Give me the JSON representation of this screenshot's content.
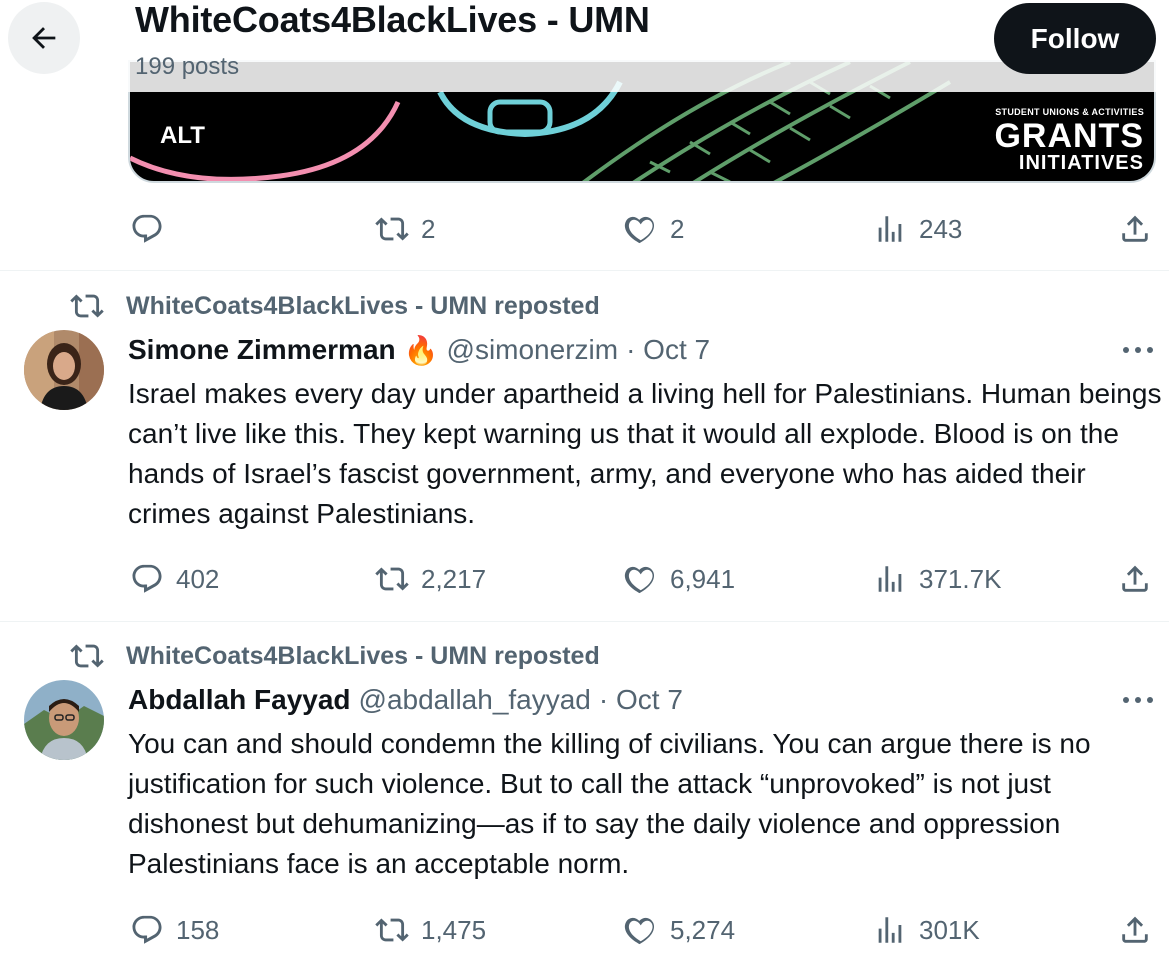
{
  "header": {
    "title": "WhiteCoats4BlackLives - UMN",
    "post_count": "199 posts",
    "follow_label": "Follow"
  },
  "first_post": {
    "media_alt_badge": "ALT",
    "media_logo_line1": "STUDENT UNIONS & ACTIVITIES",
    "media_logo_line2": "GRANTS",
    "media_logo_line3": "INITIATIVES",
    "actions": {
      "replies": "",
      "reposts": "2",
      "likes": "2",
      "views": "243"
    }
  },
  "tweets": [
    {
      "repost_label": "WhiteCoats4BlackLives - UMN reposted",
      "name": "Simone Zimmerman",
      "emoji": "🔥",
      "handle": "@simonerzim",
      "date": "· Oct 7",
      "text": "Israel makes every day under apartheid a living hell for Palestinians. Human beings can’t live like this. They kept warning us that it would all explode. Blood is on the hands of Israel’s fascist government, army, and everyone who has aided their crimes against Palestinians.",
      "actions": {
        "replies": "402",
        "reposts": "2,217",
        "likes": "6,941",
        "views": "371.7K"
      }
    },
    {
      "repost_label": "WhiteCoats4BlackLives - UMN reposted",
      "name": "Abdallah Fayyad",
      "handle": "@abdallah_fayyad",
      "date": "· Oct 7",
      "text": "You can and should condemn the killing of civilians. You can argue there is no justification for such violence. But to call the attack “unprovoked” is not just dishonest but dehumanizing—as if to say the daily violence and oppression Palestinians face is an acceptable norm.",
      "actions": {
        "replies": "158",
        "reposts": "1,475",
        "likes": "5,274",
        "views": "301K"
      }
    }
  ],
  "icons": {
    "back": "arrow-left-icon",
    "reply": "reply-icon",
    "repost": "repost-icon",
    "like": "heart-icon",
    "views": "views-icon",
    "share": "share-icon",
    "more": "more-icon"
  },
  "colors": {
    "text": "#0f1419",
    "muted": "#536471",
    "follow_bg": "#0f1419",
    "fire": "#f4900c"
  }
}
